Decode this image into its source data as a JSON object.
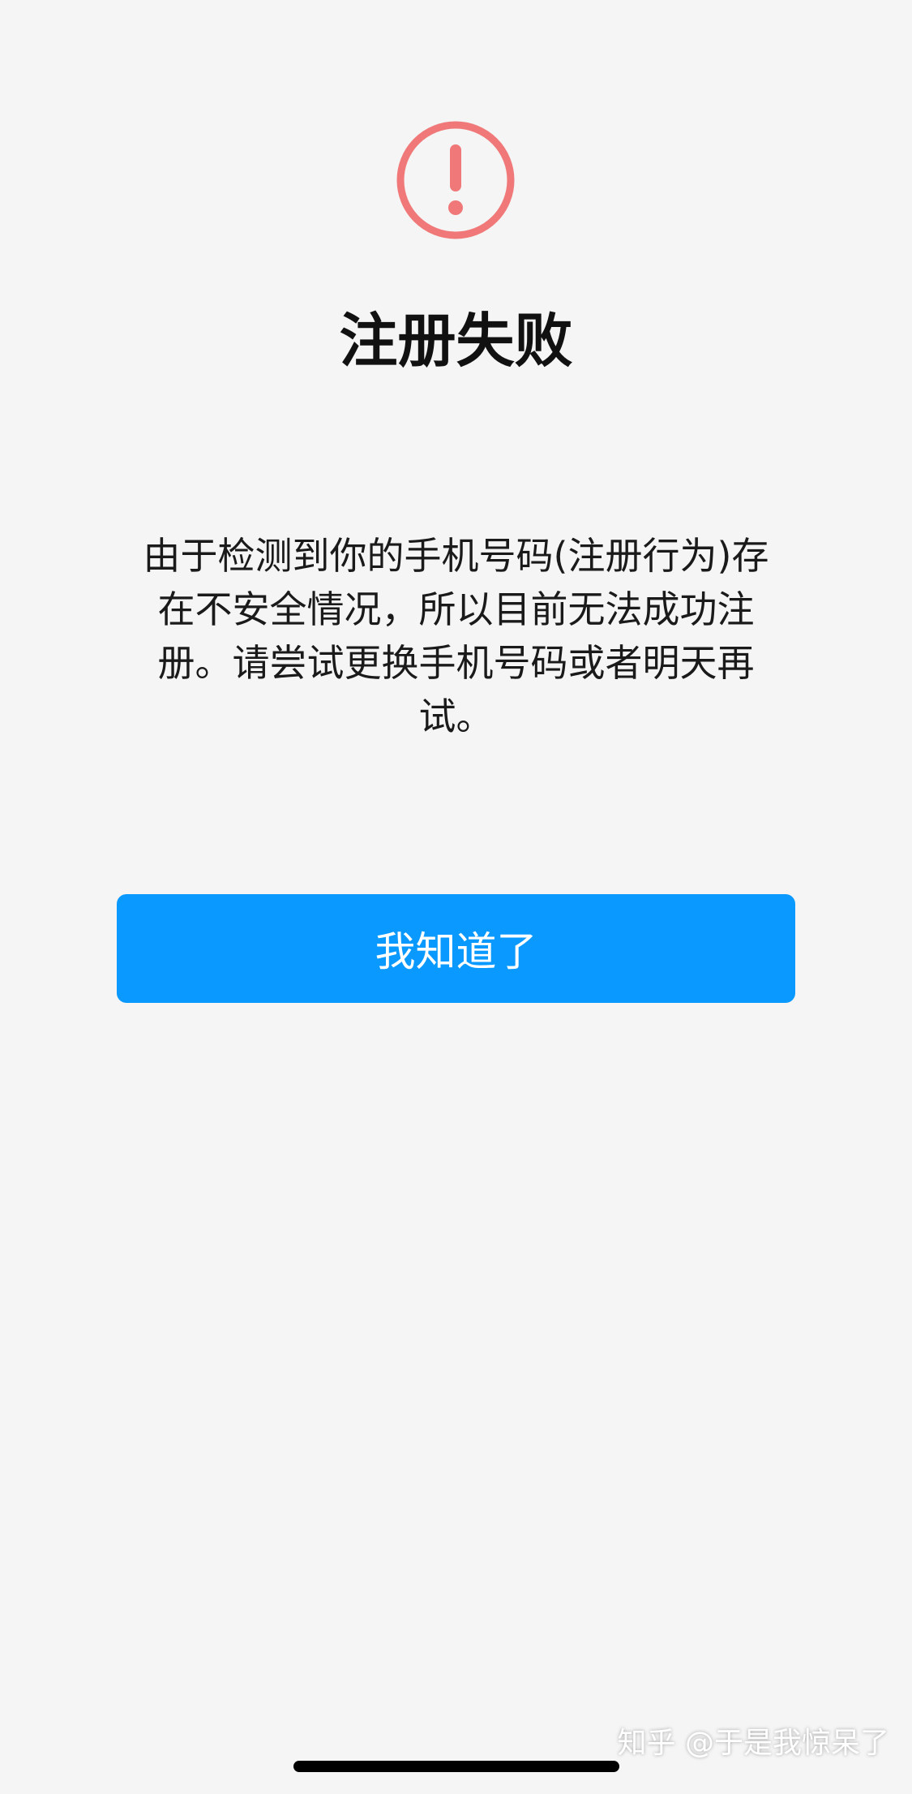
{
  "dialog": {
    "icon": "exclamation-circle-icon",
    "icon_color": "#f07878",
    "title": "注册失败",
    "message": "由于检测到你的手机号码(注册行为)存在不安全情况，所以目前无法成功注册。请尝试更换手机号码或者明天再试。",
    "button_label": "我知道了",
    "button_color": "#0a99ff"
  },
  "watermark": {
    "text": "知乎 @于是我惊呆了"
  }
}
